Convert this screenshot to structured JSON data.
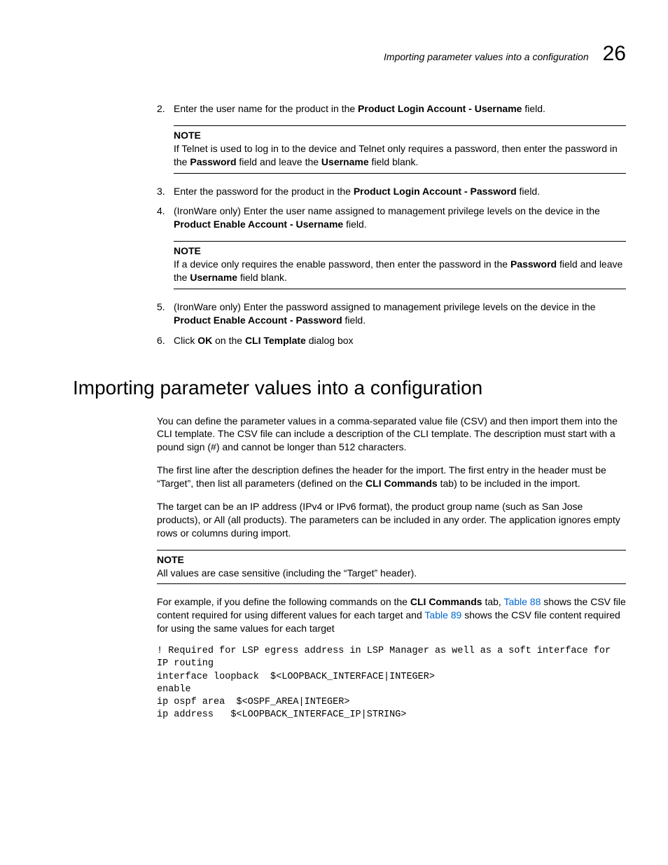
{
  "header": {
    "title": "Importing parameter values into a configuration",
    "chapter_number": "26"
  },
  "steps": [
    {
      "n": "2.",
      "segments": [
        {
          "t": "Enter the user name for the product in the "
        },
        {
          "t": "Product Login Account - Username",
          "b": true
        },
        {
          "t": " field."
        }
      ]
    },
    {
      "note": {
        "label": "NOTE",
        "segments": [
          {
            "t": "If Telnet is used to log in to the device and Telnet only requires a password, then enter the password in the "
          },
          {
            "t": "Password",
            "b": true
          },
          {
            "t": " field and leave the "
          },
          {
            "t": "Username",
            "b": true
          },
          {
            "t": " field blank."
          }
        ]
      }
    },
    {
      "n": "3.",
      "segments": [
        {
          "t": "Enter the password for the product in the "
        },
        {
          "t": "Product Login Account - Password",
          "b": true
        },
        {
          "t": " field."
        }
      ]
    },
    {
      "n": "4.",
      "segments": [
        {
          "t": "(IronWare only) Enter the user name assigned to management privilege levels on the device in the "
        },
        {
          "t": "Product Enable Account - Username",
          "b": true
        },
        {
          "t": " field."
        }
      ]
    },
    {
      "note": {
        "label": "NOTE",
        "segments": [
          {
            "t": "If a device only requires the enable password, then enter the password in the "
          },
          {
            "t": "Password",
            "b": true
          },
          {
            "t": " field and leave the "
          },
          {
            "t": "Username",
            "b": true
          },
          {
            "t": " field blank."
          }
        ]
      }
    },
    {
      "n": "5.",
      "segments": [
        {
          "t": "(IronWare only) Enter the password assigned to management privilege levels on the device in the "
        },
        {
          "t": "Product Enable Account - Password",
          "b": true
        },
        {
          "t": " field."
        }
      ]
    },
    {
      "n": "6.",
      "segments": [
        {
          "t": "Click "
        },
        {
          "t": "OK",
          "b": true
        },
        {
          "t": " on the "
        },
        {
          "t": "CLI Template",
          "b": true
        },
        {
          "t": " dialog box"
        }
      ]
    }
  ],
  "section": {
    "heading": "Importing parameter values into a configuration",
    "paragraphs": [
      {
        "segments": [
          {
            "t": "You can define the parameter values in a comma-separated value file (CSV) and then import them into the CLI template. The CSV file can include a description of the CLI template. The description must start with a pound sign (#) and cannot be longer than 512 characters."
          }
        ]
      },
      {
        "segments": [
          {
            "t": "The first line after the description defines the header for the import. The first entry in the header must be “Target”, then list all parameters (defined on the "
          },
          {
            "t": "CLI Commands",
            "b": true
          },
          {
            "t": " tab) to be included in the import."
          }
        ]
      },
      {
        "segments": [
          {
            "t": "The target can be an IP address (IPv4 or IPv6 format), the product group name (such as San Jose products), or All (all products). The parameters can be included in any order. The application ignores empty rows or columns during import."
          }
        ]
      }
    ],
    "note": {
      "label": "NOTE",
      "segments": [
        {
          "t": "All values are case sensitive (including the “Target” header)."
        }
      ]
    },
    "after_note": {
      "segments": [
        {
          "t": "For example, if you define the following commands on the "
        },
        {
          "t": "CLI Commands",
          "b": true
        },
        {
          "t": " tab, "
        },
        {
          "t": "Table 88",
          "link": true
        },
        {
          "t": " shows the CSV file content required for using different values for each target and "
        },
        {
          "t": "Table 89",
          "link": true
        },
        {
          "t": " shows the CSV file content required for using the same values for each target"
        }
      ]
    },
    "code": "! Required for LSP egress address in LSP Manager as well as a soft interface for IP routing\ninterface loopback  $<LOOPBACK_INTERFACE|INTEGER>\nenable\nip ospf area  $<OSPF_AREA|INTEGER>\nip address   $<LOOPBACK_INTERFACE_IP|STRING>"
  }
}
